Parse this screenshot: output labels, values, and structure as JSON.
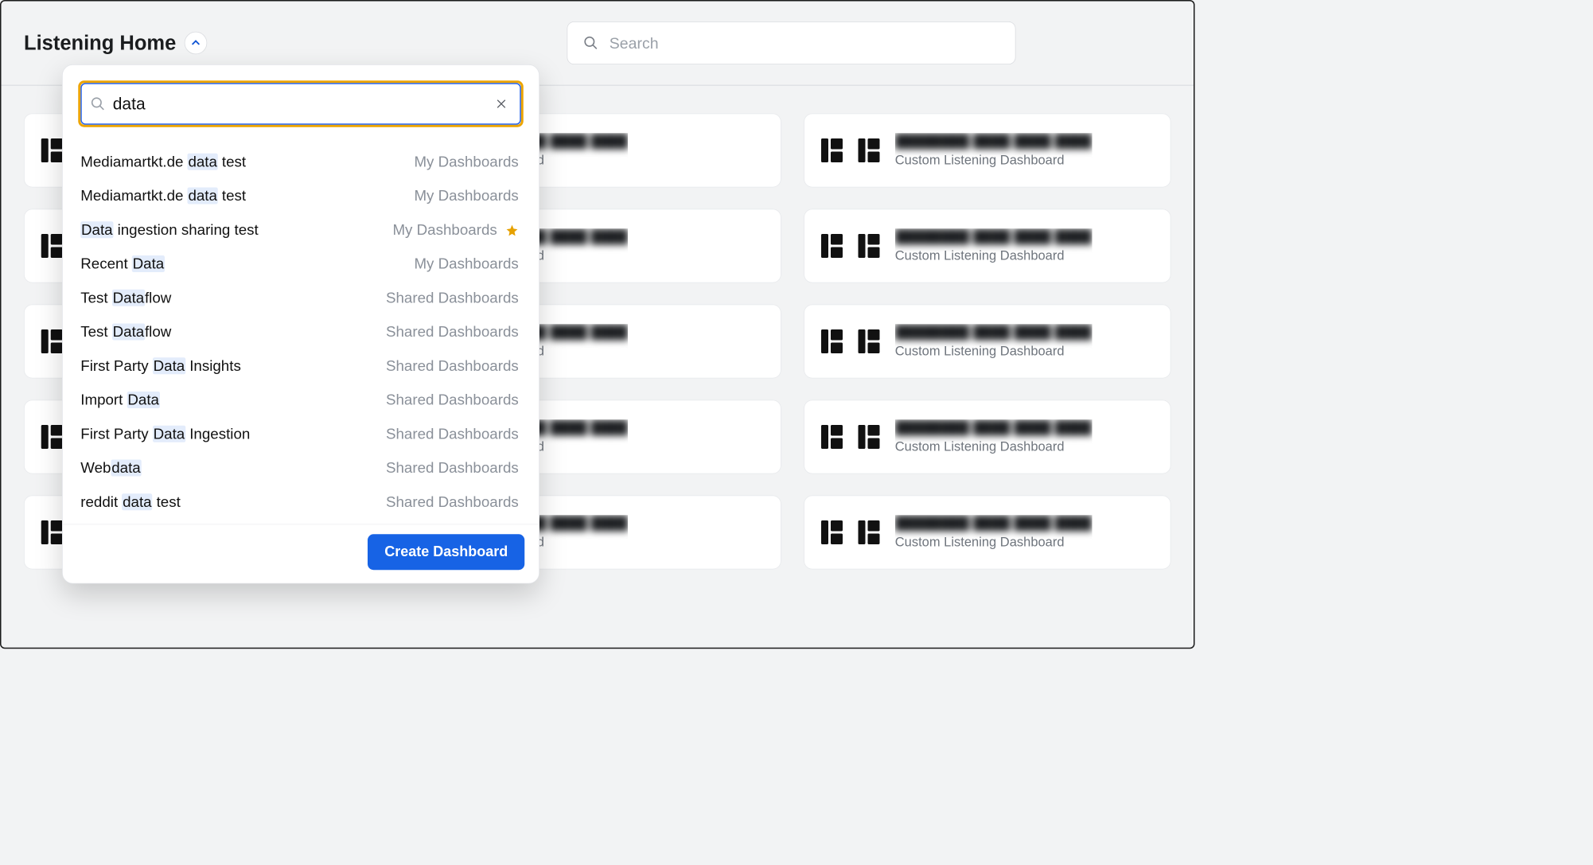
{
  "header": {
    "title": "Listening Home",
    "search_placeholder": "Search"
  },
  "dropdown": {
    "query": "data",
    "create_label": "Create Dashboard",
    "results": [
      {
        "name_parts": [
          "Mediamartkt.de ",
          "data",
          " test"
        ],
        "category": "My Dashboards",
        "starred": false
      },
      {
        "name_parts": [
          "Mediamartkt.de ",
          "data",
          " test"
        ],
        "category": "My Dashboards",
        "starred": false
      },
      {
        "name_parts": [
          "",
          "Data",
          " ingestion sharing test"
        ],
        "category": "My Dashboards",
        "starred": true
      },
      {
        "name_parts": [
          "Recent ",
          "Data",
          ""
        ],
        "category": "My Dashboards",
        "starred": false
      },
      {
        "name_parts": [
          "Test ",
          "Data",
          "flow"
        ],
        "category": "Shared Dashboards",
        "starred": false
      },
      {
        "name_parts": [
          "Test ",
          "Data",
          "flow"
        ],
        "category": "Shared Dashboards",
        "starred": false
      },
      {
        "name_parts": [
          "First Party ",
          "Data",
          " Insights"
        ],
        "category": "Shared Dashboards",
        "starred": false
      },
      {
        "name_parts": [
          "Import ",
          "Data",
          ""
        ],
        "category": "Shared Dashboards",
        "starred": false
      },
      {
        "name_parts": [
          "First Party ",
          "Data",
          " Ingestion"
        ],
        "category": "Shared Dashboards",
        "starred": false
      },
      {
        "name_parts": [
          "Web",
          "data",
          ""
        ],
        "category": "Shared Dashboards",
        "starred": false
      },
      {
        "name_parts": [
          "reddit ",
          "data",
          " test"
        ],
        "category": "Shared Dashboards",
        "starred": false
      }
    ]
  },
  "cards_col2": [
    {
      "title": "████████ ████ ████ ████",
      "subtitle": "Custom Listening Dashboard"
    },
    {
      "title": "████████ ████ ████ ████",
      "subtitle": "Custom Listening Dashboard"
    },
    {
      "title": "████████ ████ ████ ████",
      "subtitle": "Custom Listening Dashboard"
    },
    {
      "title": "████████ ████ ████ ████",
      "subtitle": "Custom Listening Dashboard"
    },
    {
      "title": "████████ ████ ████ ████",
      "subtitle": "Custom Listening Dashboard"
    }
  ],
  "cards_col3": [
    {
      "title": "████████ ████ ████ ████",
      "subtitle": "Custom Listening Dashboard"
    },
    {
      "title": "████████ ████ ████ ████",
      "subtitle": "Custom Listening Dashboard"
    },
    {
      "title": "████████ ████ ████ ████",
      "subtitle": "Custom Listening Dashboard"
    },
    {
      "title": "████████ ████ ████ ████",
      "subtitle": "Custom Listening Dashboard"
    },
    {
      "title": "████████ ████ ████ ████",
      "subtitle": "Custom Listening Dashboard"
    }
  ]
}
